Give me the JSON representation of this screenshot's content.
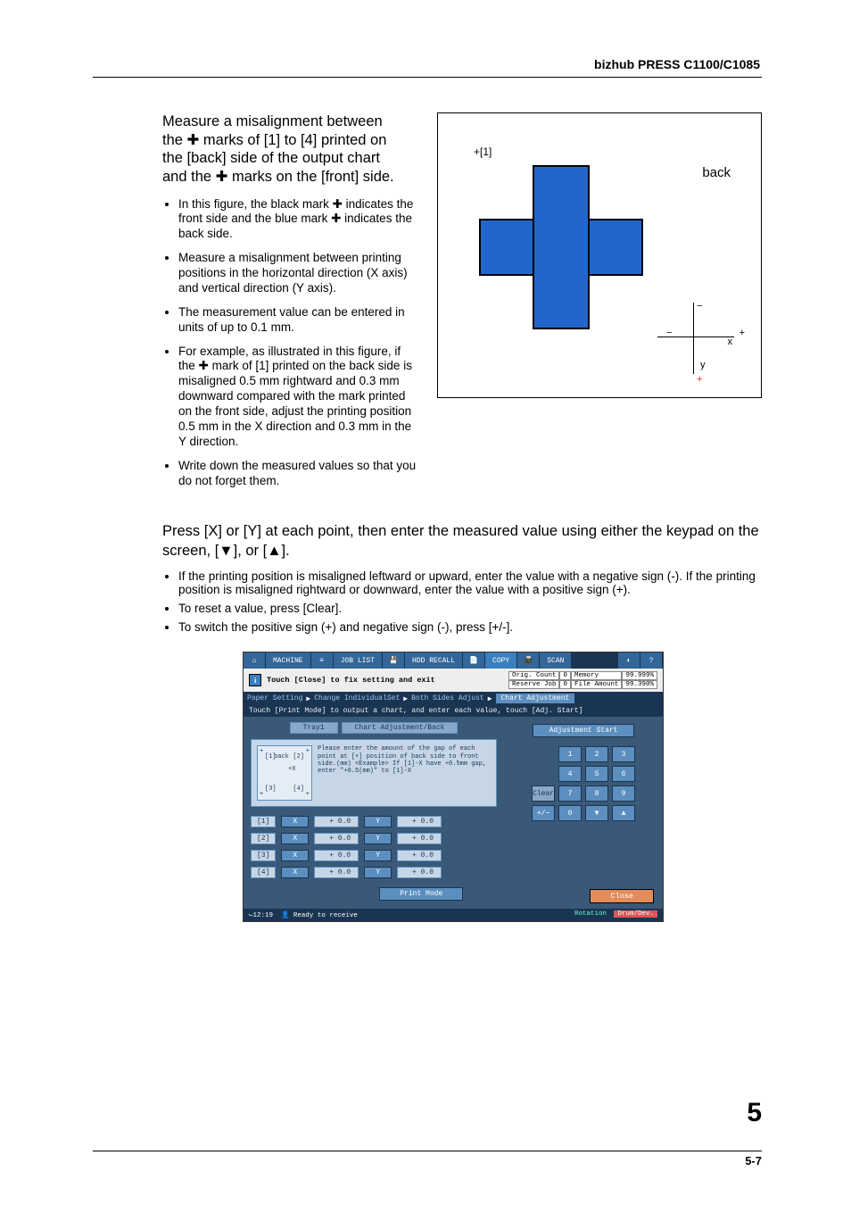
{
  "header": {
    "product": "bizhub PRESS C1100/C1085"
  },
  "intro": {
    "measure_text": "Measure a misalignment between the ✚ marks of [1] to [4] printed on the [back] side of the output chart and the ✚ marks on the [front] side.",
    "bullets": [
      "In this figure, the black mark ✚ indicates the front side and the blue mark ✚ indicates the back side.",
      "Measure a misalignment between printing positions in the horizontal direction (X axis) and vertical direction (Y axis).",
      "The measurement value can be entered in units of up to 0.1 mm.",
      "For example, as illustrated in this figure, if the ✚ mark of [1] printed on the back side is misaligned 0.5 mm rightward and 0.3 mm downward compared with the mark printed on the front side, adjust the printing position 0.5 mm in the X direction and 0.3 mm in the Y direction.",
      "Write down the measured values so that you do not forget them."
    ]
  },
  "diagram": {
    "mark1": "[1]",
    "back_label": "back",
    "x_label": "x",
    "y_label": "y"
  },
  "press_text": "Press [X] or [Y] at each point, then enter the measured value using either the keypad on the screen, [▼], or [▲].",
  "press_bullets": [
    "If the printing position is misaligned leftward or upward, enter the value with a negative sign (-). If the printing position is misaligned rightward or downward, enter the value with a positive sign (+).",
    "To reset a value, press [Clear].",
    "To switch the positive sign (+) and negative sign (-), press [+/-]."
  ],
  "panel": {
    "tabs": {
      "machine": "MACHINE",
      "joblist": "JOB LIST",
      "hdd": "HDD RECALL",
      "copy": "COPY",
      "scan": "SCAN"
    },
    "info_bar": "Touch [Close] to fix setting and exit",
    "readouts": {
      "orig_count_label": "Orig. Count",
      "orig_count_value": "0",
      "reserve_job_label": "Reserve Job",
      "reserve_job_value": "0",
      "memory_label": "Memory",
      "memory_value": "99.999%",
      "file_amount_label": "File Amount",
      "file_amount_value": "99.390%"
    },
    "breadcrumb": {
      "paper": "Paper Setting",
      "change": "Change IndividualSet",
      "sides": "Both Sides Adjust",
      "current": "Chart Adjustment"
    },
    "hint": "Touch [Print Mode] to output a chart, and enter each value, touch [Adj. Start]",
    "chips": {
      "tray": "Tray1",
      "chart": "Chart Adjustment/Back"
    },
    "example": {
      "corners": {
        "tl": "[1]",
        "tr": "[2]",
        "bl": "[3]",
        "br": "[4]"
      },
      "back_label": "back",
      "plus_x": "+X",
      "text": "Please enter the amount of the gap of each point at [+] position of back side to front side.(mm)\n<Example>\nIf [1]-X have +0.5mm gap, enter \"+0.5(mm)\" to [1]-X"
    },
    "rows": [
      {
        "label": "[1]",
        "x_axis": "X",
        "x_val": "+ 0.0",
        "y_axis": "Y",
        "y_val": "+ 0.0"
      },
      {
        "label": "[2]",
        "x_axis": "X",
        "x_val": "+ 0.0",
        "y_axis": "Y",
        "y_val": "+ 0.0"
      },
      {
        "label": "[3]",
        "x_axis": "X",
        "x_val": "+ 0.0",
        "y_axis": "Y",
        "y_val": "+ 0.0"
      },
      {
        "label": "[4]",
        "x_axis": "X",
        "x_val": "+ 0.0",
        "y_axis": "Y",
        "y_val": "+ 0.0"
      }
    ],
    "adj_start": "Adjustment Start",
    "keypad": {
      "k1": "1",
      "k2": "2",
      "k3": "3",
      "k4": "4",
      "k5": "5",
      "k6": "6",
      "k7": "7",
      "k8": "8",
      "k9": "9",
      "k0": "0",
      "clear": "Clear",
      "pm": "+/−",
      "down": "▼",
      "up": "▲"
    },
    "print_mode": "Print Mode",
    "close": "Close",
    "status": {
      "time": "⌙12:19",
      "ready": "Ready to receive",
      "rotation": "Rotation",
      "drum": "Drum/Dev."
    }
  },
  "chapter_num": "5",
  "page_num": "5-7"
}
